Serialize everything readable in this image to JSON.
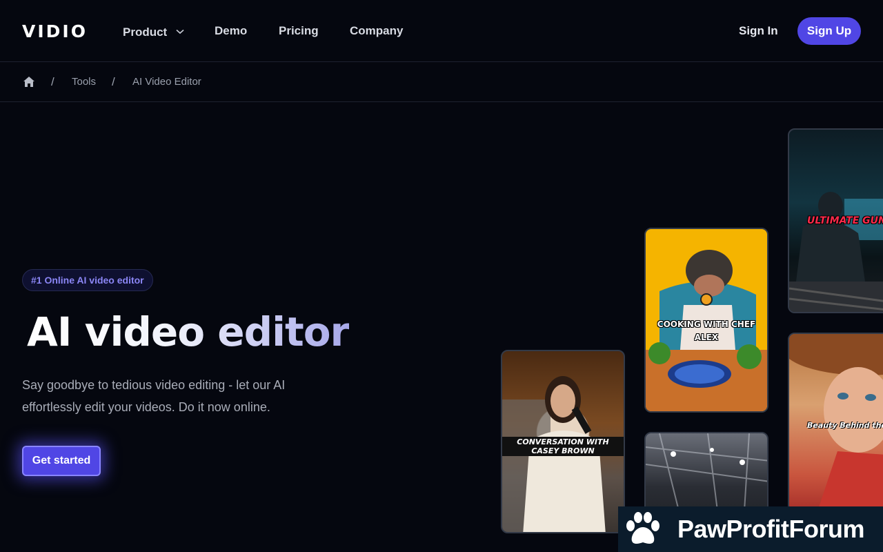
{
  "brand": {
    "logo": "VIDIO"
  },
  "nav": {
    "links": [
      {
        "label": "Product",
        "has_dropdown": true
      },
      {
        "label": "Demo"
      },
      {
        "label": "Pricing"
      },
      {
        "label": "Company"
      }
    ],
    "sign_in": "Sign In",
    "sign_up": "Sign Up"
  },
  "breadcrumb": {
    "items": [
      "Tools",
      "AI Video Editor"
    ],
    "separator": "/"
  },
  "hero": {
    "badge": "#1 Online AI video editor",
    "title": "AI video editor",
    "subtitle": "Say goodbye to tedious video editing - let our AI effortlessly edit your videos. Do it now online.",
    "cta": "Get started"
  },
  "videos": [
    {
      "caption": "CONVERSATION WITH CASEY BROWN"
    },
    {
      "caption": "COOKING WITH CHEF ALEX"
    },
    {
      "caption": ""
    },
    {
      "caption": "ULTIMATE GUNFIGH"
    },
    {
      "caption": "Beauty Behind the Scen"
    }
  ],
  "watermark": {
    "text": "PawProfitForum"
  },
  "colors": {
    "background": "#05070f",
    "accent": "#5046e5",
    "badge_text": "#8b86f5"
  }
}
